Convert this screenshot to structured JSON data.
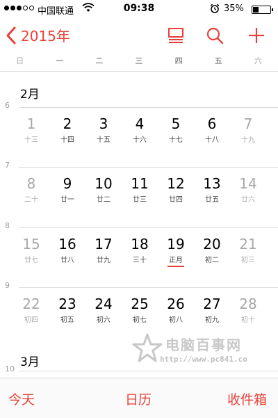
{
  "status_bar": {
    "carrier": "中国联通",
    "time": "09:38",
    "battery": "35%",
    "battery_level": 0.35,
    "signal_bars": 3,
    "signal_total": 5
  },
  "nav": {
    "back_label": "2015年",
    "icons": [
      "list-view-icon",
      "search-icon",
      "add-icon"
    ],
    "accent_color": "#e8413a"
  },
  "weekdays": [
    "日",
    "一",
    "二",
    "三",
    "四",
    "五",
    "六"
  ],
  "months": [
    {
      "title": "2月",
      "weeks": [
        {
          "number": "6",
          "days": [
            {
              "num": "1",
              "lunar": "十三"
            },
            {
              "num": "2",
              "lunar": "十四"
            },
            {
              "num": "3",
              "lunar": "十五"
            },
            {
              "num": "4",
              "lunar": "十六"
            },
            {
              "num": "5",
              "lunar": "十七"
            },
            {
              "num": "6",
              "lunar": "十八"
            },
            {
              "num": "7",
              "lunar": "十九"
            }
          ]
        },
        {
          "number": "7",
          "days": [
            {
              "num": "8",
              "lunar": "二十"
            },
            {
              "num": "9",
              "lunar": "廿一"
            },
            {
              "num": "10",
              "lunar": "廿二"
            },
            {
              "num": "11",
              "lunar": "廿三"
            },
            {
              "num": "12",
              "lunar": "廿四"
            },
            {
              "num": "13",
              "lunar": "廿五"
            },
            {
              "num": "14",
              "lunar": "廿六"
            }
          ]
        },
        {
          "number": "8",
          "days": [
            {
              "num": "15",
              "lunar": "廿七"
            },
            {
              "num": "16",
              "lunar": "廿八"
            },
            {
              "num": "17",
              "lunar": "廿九"
            },
            {
              "num": "18",
              "lunar": "三十"
            },
            {
              "num": "19",
              "lunar": "正月",
              "highlight": true
            },
            {
              "num": "20",
              "lunar": "初二"
            },
            {
              "num": "21",
              "lunar": "初三"
            }
          ]
        },
        {
          "number": "9",
          "days": [
            {
              "num": "22",
              "lunar": "初四"
            },
            {
              "num": "23",
              "lunar": "初五"
            },
            {
              "num": "24",
              "lunar": "初六"
            },
            {
              "num": "25",
              "lunar": "初七"
            },
            {
              "num": "26",
              "lunar": "初八"
            },
            {
              "num": "27",
              "lunar": "初九"
            },
            {
              "num": "28",
              "lunar": "初十"
            }
          ]
        }
      ]
    },
    {
      "title": "3月",
      "weeks": [
        {
          "number": "10",
          "days": []
        }
      ]
    }
  ],
  "watermark": {
    "title": "电脑百事网",
    "url": "http://www.pc841.co"
  },
  "toolbar": {
    "today": "今天",
    "calendars": "日历",
    "inbox": "收件箱"
  }
}
